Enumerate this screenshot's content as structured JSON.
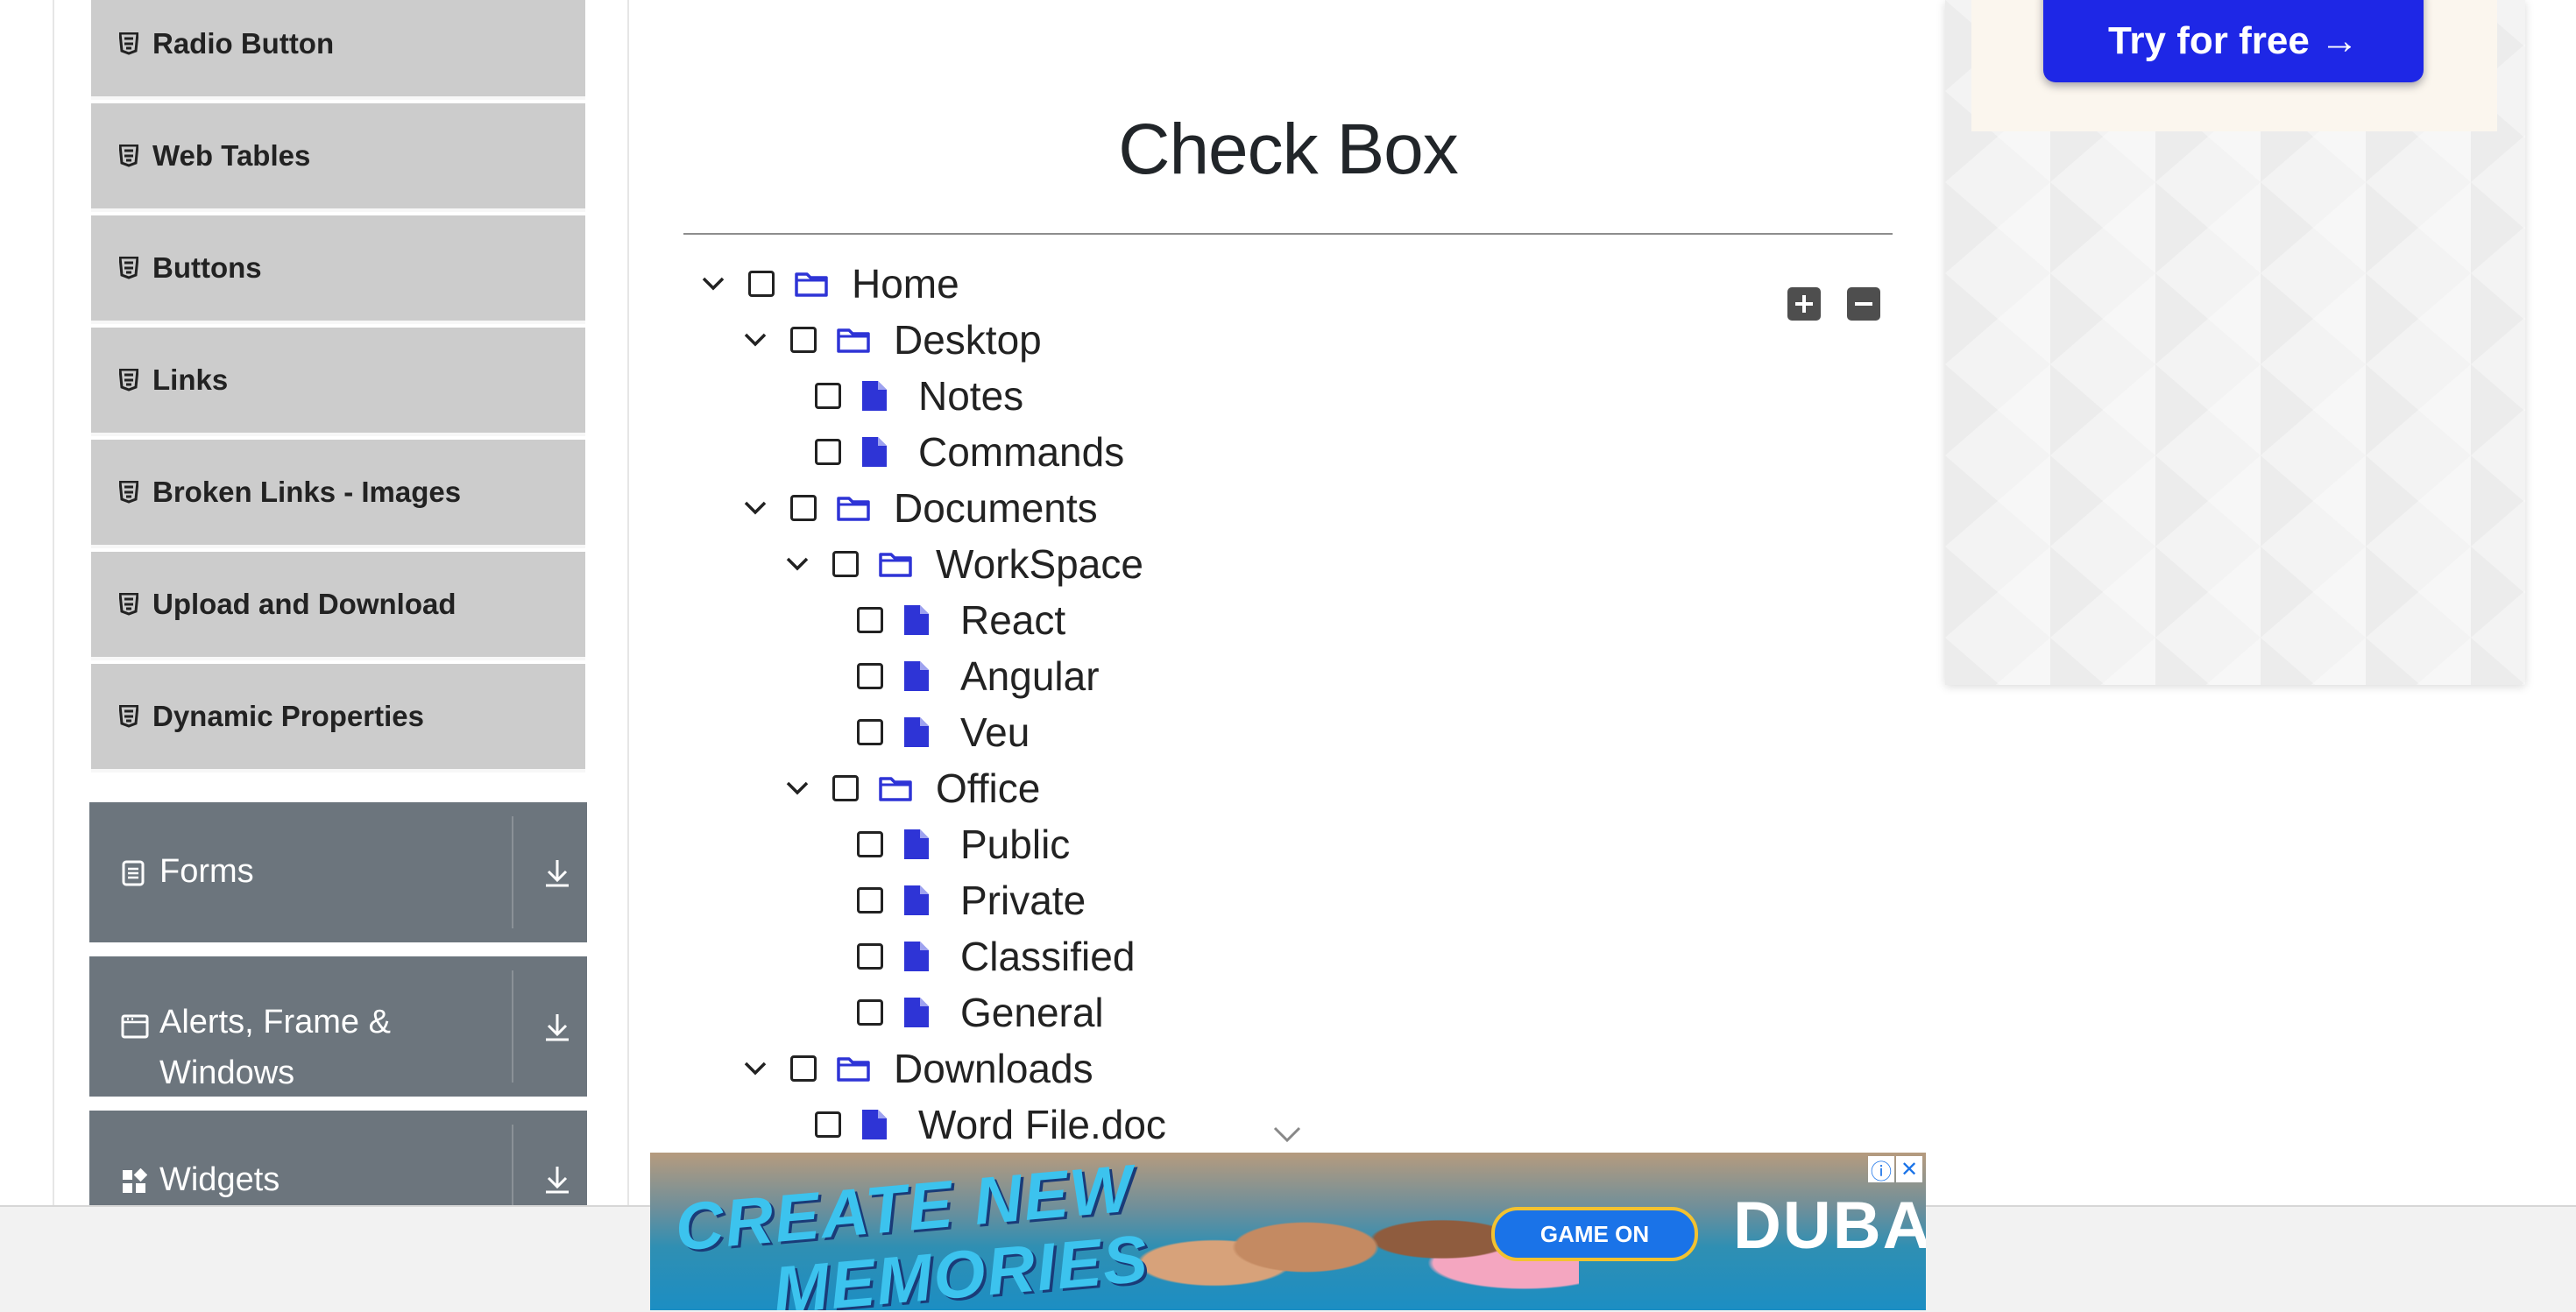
{
  "sidebar": {
    "items": [
      {
        "label": "Radio Button"
      },
      {
        "label": "Web Tables"
      },
      {
        "label": "Buttons"
      },
      {
        "label": "Links"
      },
      {
        "label": "Broken Links - Images"
      },
      {
        "label": "Upload and Download"
      },
      {
        "label": "Dynamic Properties"
      }
    ],
    "groups": [
      {
        "label": "Forms",
        "icon": "form-icon"
      },
      {
        "label_line1": "Alerts, Frame &",
        "label_line2": "Windows",
        "icon": "window-icon"
      },
      {
        "label": "Widgets",
        "icon": "widgets-icon"
      }
    ]
  },
  "main": {
    "title": "Check Box",
    "tree": [
      {
        "label": "Home",
        "type": "folder"
      },
      {
        "label": "Desktop",
        "type": "folder"
      },
      {
        "label": "Notes",
        "type": "file"
      },
      {
        "label": "Commands",
        "type": "file"
      },
      {
        "label": "Documents",
        "type": "folder"
      },
      {
        "label": "WorkSpace",
        "type": "folder"
      },
      {
        "label": "React",
        "type": "file"
      },
      {
        "label": "Angular",
        "type": "file"
      },
      {
        "label": "Veu",
        "type": "file"
      },
      {
        "label": "Office",
        "type": "folder"
      },
      {
        "label": "Public",
        "type": "file"
      },
      {
        "label": "Private",
        "type": "file"
      },
      {
        "label": "Classified",
        "type": "file"
      },
      {
        "label": "General",
        "type": "file"
      },
      {
        "label": "Downloads",
        "type": "folder"
      },
      {
        "label": "Word File.doc",
        "type": "file"
      }
    ]
  },
  "ads": {
    "side_button": "Try for free →",
    "banner_line1": "CREATE NEW",
    "banner_line2": "MEMORIES",
    "banner_button": "GAME ON",
    "banner_brand": "DUBAI"
  },
  "colors": {
    "accent": "#2e34d6",
    "sidebar_item": "#cccccc",
    "group": "#6c757d"
  }
}
